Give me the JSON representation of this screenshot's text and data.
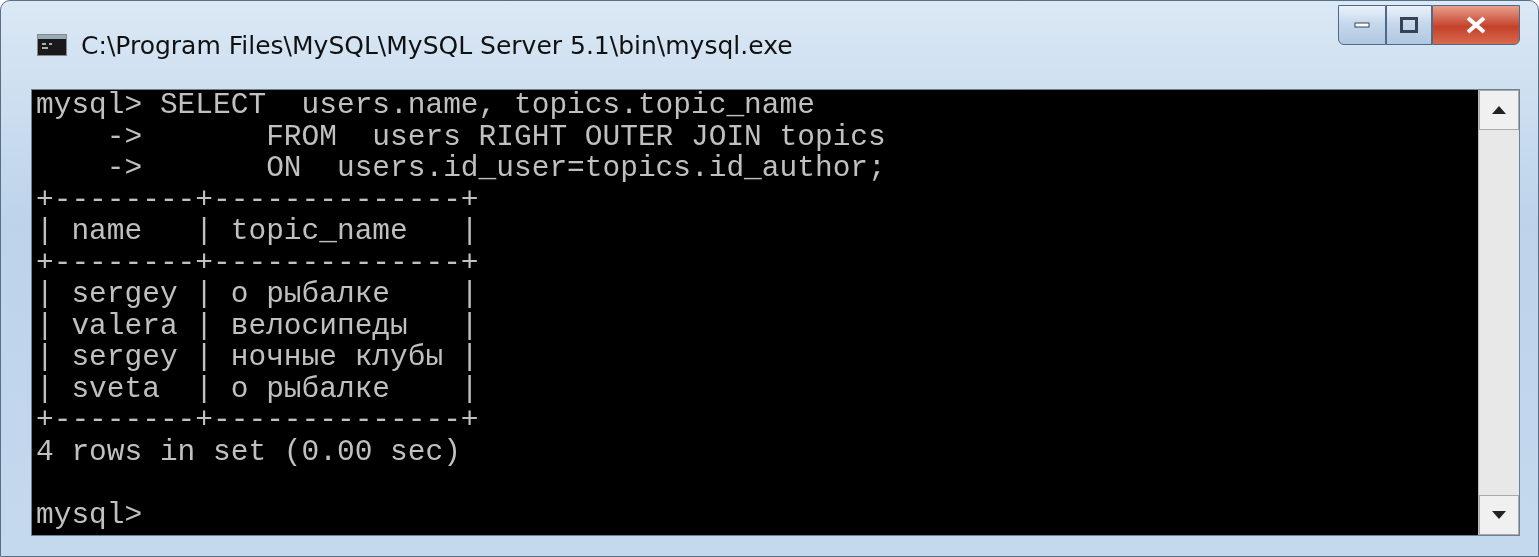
{
  "window": {
    "title": "C:\\Program Files\\MySQL\\MySQL Server 5.1\\bin\\mysql.exe"
  },
  "console": {
    "lines": [
      "mysql> SELECT  users.name, topics.topic_name",
      "    ->       FROM  users RIGHT OUTER JOIN topics",
      "    ->       ON  users.id_user=topics.id_author;",
      "+--------+--------------+",
      "| name   | topic_name   |",
      "+--------+--------------+",
      "| sergey | о рыбалке    |",
      "| valera | велосипеды   |",
      "| sergey | ночные клубы |",
      "| sveta  | о рыбалке    |",
      "+--------+--------------+",
      "4 rows in set (0.00 sec)"
    ],
    "prompt": "mysql>"
  }
}
